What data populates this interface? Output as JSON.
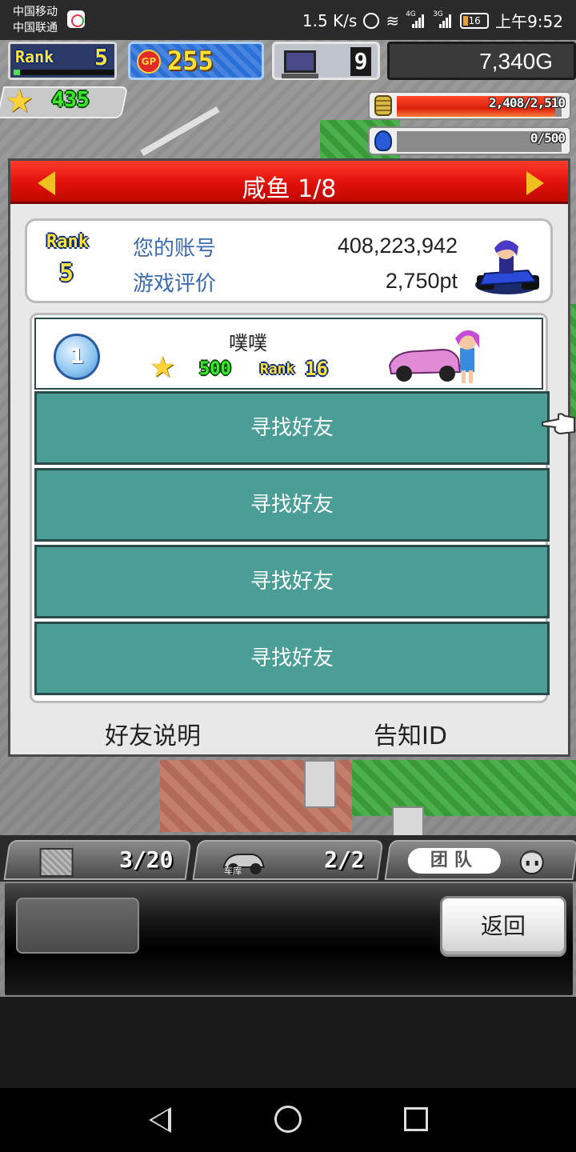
{
  "status_bar": {
    "carrier_1": "中国移动",
    "carrier_2": "中国联通",
    "net_speed": "1.5 K/s",
    "signal_1": "4G",
    "signal_2": "3G",
    "battery": "16",
    "time": "上午9:52"
  },
  "hud": {
    "rank_label": "Rank",
    "rank_value": "5",
    "gp_label": "GP",
    "gp_value": "255",
    "pc_value": "9",
    "gold": "7,340G",
    "stars": "435",
    "coins_text": "2,408/2,510",
    "coins_fraction": 0.959,
    "fuel_text": "0/500",
    "fuel_fraction": 0.0
  },
  "dialog": {
    "title": "咸鱼 1/8",
    "profile": {
      "rank_label": "Rank",
      "rank_value": "5",
      "account_label": "您的账号",
      "account_value": "408,223,942",
      "rating_label": "游戏评价",
      "rating_value": "2,750pt"
    },
    "friend": {
      "position": "1",
      "name": "噗噗",
      "stars": "500",
      "rank_label": "Rank",
      "rank_value": "16"
    },
    "slots": [
      "寻找好友",
      "寻找好友",
      "寻找好友",
      "寻找好友"
    ],
    "help_link": "好友说明",
    "report_link": "告知ID"
  },
  "toolbar": {
    "tab1_count": "3/20",
    "tab2_label": "车库",
    "tab2_count": "2/2",
    "tab3_label": "团队",
    "back_button": "返回"
  }
}
